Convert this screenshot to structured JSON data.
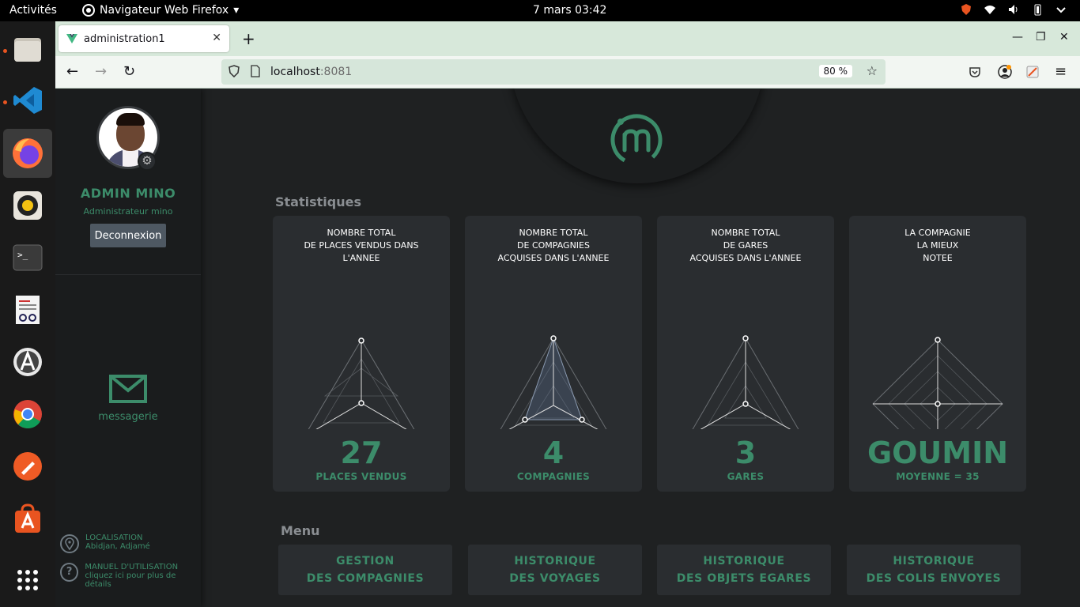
{
  "system": {
    "activities": "Activités",
    "app_name": "Navigateur Web Firefox",
    "clock": "7 mars  03:42"
  },
  "browser": {
    "tab_title": "administration1",
    "url_host": "localhost",
    "url_port": ":8081",
    "zoom": "80 %"
  },
  "sidebar": {
    "name": "ADMIN MINO",
    "role": "Administrateur mino",
    "logout": "Deconnexion",
    "messaging": "messagerie",
    "location_title": "LOCALISATION",
    "location_value": "Abidjan, Adjamé",
    "manual_title": "MANUEL D'UTILISATION",
    "manual_value": "cliquez ici pour plus de détails"
  },
  "stats": {
    "title": "Statistiques",
    "cards": [
      {
        "title": "NOMBRE TOTAL\nDE PLACES VENDUS DANS\nL'ANNEE",
        "value": "27",
        "unit": "PLACES VENDUS"
      },
      {
        "title": "NOMBRE TOTAL\nDE COMPAGNIES\nACQUISES DANS L'ANNEE",
        "value": "4",
        "unit": "COMPAGNIES"
      },
      {
        "title": "NOMBRE TOTAL\nDE GARES\nACQUISES DANS L'ANNEE",
        "value": "3",
        "unit": "GARES"
      },
      {
        "title": "LA COMPAGNIE\nLA MIEUX\nNOTEE",
        "value": "GOUMIN",
        "unit": "MOYENNE = 35"
      }
    ]
  },
  "menu": {
    "title": "Menu",
    "items": [
      {
        "line1": "GESTION",
        "line2": "DES COMPAGNIES"
      },
      {
        "line1": "HISTORIQUE",
        "line2": "DES VOYAGES"
      },
      {
        "line1": "HISTORIQUE",
        "line2": "DES OBJETS EGARES"
      },
      {
        "line1": "HISTORIQUE",
        "line2": "DES COLIS ENVOYES"
      }
    ]
  },
  "colors": {
    "accent": "#3c8c6a",
    "card": "#2a2d30",
    "background": "#1f2122"
  }
}
